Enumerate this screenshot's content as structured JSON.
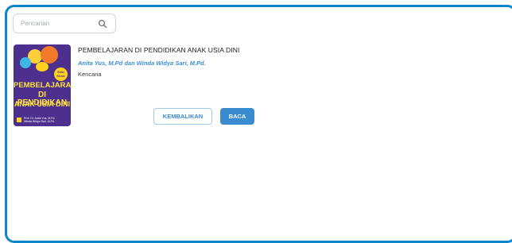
{
  "search": {
    "placeholder": "Pencarian",
    "value": "",
    "icon": "search-icon"
  },
  "book": {
    "title": "PEMBELAJARAN DI PENDIDIKAN ANAK USIA DINI",
    "author": "Anita Yus, M.Pd dan Winda Widya Sari, M.Pd.",
    "publisher": "Kencana",
    "cover": {
      "title_lines": [
        "PEMBELAJARAN",
        "DI PENDIDIKAN",
        "ANAK USIA DINI"
      ],
      "badge": "Edisi Revisi",
      "authors_lines": [
        "Prof. Dr. Anita Yus, M.Pd",
        "Winda Widya Sari, M.Pd"
      ]
    }
  },
  "actions": {
    "return_label": "KEMBALIKAN",
    "read_label": "BACA"
  },
  "colors": {
    "frame": "#0a86c9",
    "accent": "#3b8bd0",
    "cover_bg": "#4d2f8e",
    "cover_text": "#ffe23a"
  }
}
